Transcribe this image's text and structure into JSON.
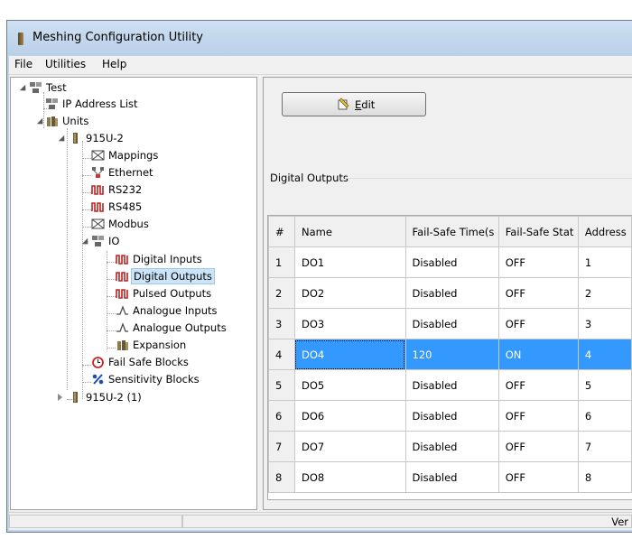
{
  "window": {
    "title": "Meshing Configuration Utility"
  },
  "menu": {
    "items": [
      "File",
      "Utilities",
      "Help"
    ]
  },
  "tree": {
    "root": "Test",
    "ip_list": "IP Address List",
    "units": "Units",
    "unit1": "915U-2",
    "mappings": "Mappings",
    "ethernet": "Ethernet",
    "rs232": "RS232",
    "rs485": "RS485",
    "modbus": "Modbus",
    "io": "IO",
    "digital_inputs": "Digital Inputs",
    "digital_outputs": "Digital Outputs",
    "pulsed_outputs": "Pulsed Outputs",
    "analogue_inputs": "Analogue Inputs",
    "analogue_outputs": "Analogue Outputs",
    "expansion": "Expansion",
    "fail_safe_blocks": "Fail Safe Blocks",
    "sensitivity_blocks": "Sensitivity Blocks",
    "unit2": "915U-2 (1)",
    "selected": "digital_outputs"
  },
  "toolbar": {
    "edit_label": "Edit"
  },
  "section": {
    "title": "Digital Outputs"
  },
  "grid": {
    "columns": [
      "#",
      "Name",
      "Fail-Safe Time(s",
      "Fail-Safe Stat",
      "Address"
    ],
    "rows": [
      [
        "1",
        "DO1",
        "Disabled",
        "OFF",
        "1"
      ],
      [
        "2",
        "DO2",
        "Disabled",
        "OFF",
        "2"
      ],
      [
        "3",
        "DO3",
        "Disabled",
        "OFF",
        "3"
      ],
      [
        "4",
        "DO4",
        "120",
        "ON",
        "4"
      ],
      [
        "5",
        "DO5",
        "Disabled",
        "OFF",
        "5"
      ],
      [
        "6",
        "DO6",
        "Disabled",
        "OFF",
        "6"
      ],
      [
        "7",
        "DO7",
        "Disabled",
        "OFF",
        "7"
      ],
      [
        "8",
        "DO8",
        "Disabled",
        "OFF",
        "8"
      ]
    ],
    "selected_row": 4
  },
  "status": {
    "text": "Ver"
  },
  "colors": {
    "selection": "#3399ff",
    "tree_selection": "#cce4f7",
    "title_bar": "#bcd3ea"
  },
  "icons": {
    "app": "app-icon",
    "network": "network-icon",
    "module": "module-icon",
    "mapping": "mapping-icon",
    "ethernet": "ethernet-icon",
    "serial": "serial-port-icon",
    "digital": "digital-signal-icon",
    "analogue": "analogue-signal-icon",
    "expansion": "expansion-icon",
    "failsafe": "alarm-clock-icon",
    "sensitivity": "percent-icon",
    "edit": "edit-icon"
  }
}
